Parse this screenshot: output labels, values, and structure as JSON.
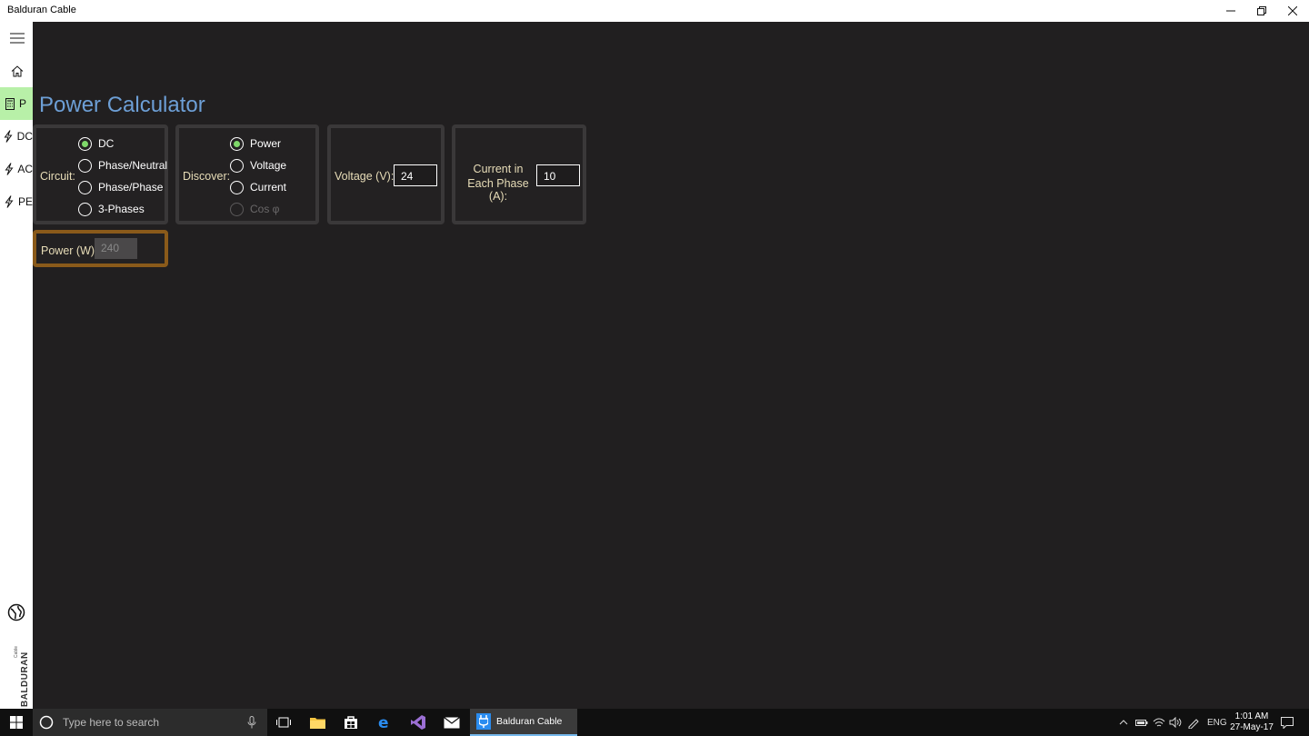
{
  "window": {
    "title": "Balduran Cable"
  },
  "nav": {
    "items": [
      {
        "label": "P"
      },
      {
        "label": "DC"
      },
      {
        "label": "AC"
      },
      {
        "label": "PE"
      }
    ]
  },
  "page": {
    "title": "Power Calculator"
  },
  "circuit": {
    "label": "Circuit:",
    "options": [
      "DC",
      "Phase/Neutral",
      "Phase/Phase",
      "3-Phases"
    ],
    "selected": "DC"
  },
  "discover": {
    "label": "Discover:",
    "options": [
      "Power",
      "Voltage",
      "Current",
      "Cos φ"
    ],
    "selected": "Power",
    "disabled": "Cos φ"
  },
  "voltage": {
    "label": "Voltage (V):",
    "value": "24"
  },
  "current": {
    "label_line1": "Current in",
    "label_line2": "Each Phase (A):",
    "value": "10"
  },
  "result": {
    "label": "Power (W)",
    "value": "240"
  },
  "taskbar": {
    "search_placeholder": "Type here to search",
    "active_app": "Balduran Cable",
    "language": "ENG",
    "time": "1:01 AM",
    "date": "27-May-17"
  },
  "colors": {
    "accent_title": "#6d9fd6",
    "radio_selected": "#7fd86a",
    "result_border": "#8a5a1a",
    "nav_active": "#b8f0a8"
  }
}
